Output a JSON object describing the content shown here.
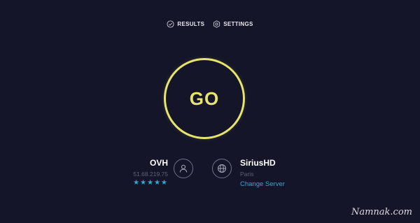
{
  "nav": {
    "results_label": "RESULTS",
    "settings_label": "SETTINGS",
    "results_icon": "check-circle-icon",
    "settings_icon": "gear-icon"
  },
  "go_button": {
    "label": "GO",
    "color": "#e6e46a"
  },
  "isp": {
    "name": "OVH",
    "ip": "51.68.219.75",
    "stars": "★★★★★",
    "rating": 5,
    "icon": "user-icon"
  },
  "server": {
    "name": "SiriusHD",
    "city": "Paris",
    "change_label": "Change Server",
    "icon": "globe-icon"
  },
  "watermark": "Namnak.com",
  "colors": {
    "background": "#141528",
    "accent_yellow": "#e6e46a",
    "link_blue": "#3aa4d1",
    "muted_text": "#5f6277"
  }
}
